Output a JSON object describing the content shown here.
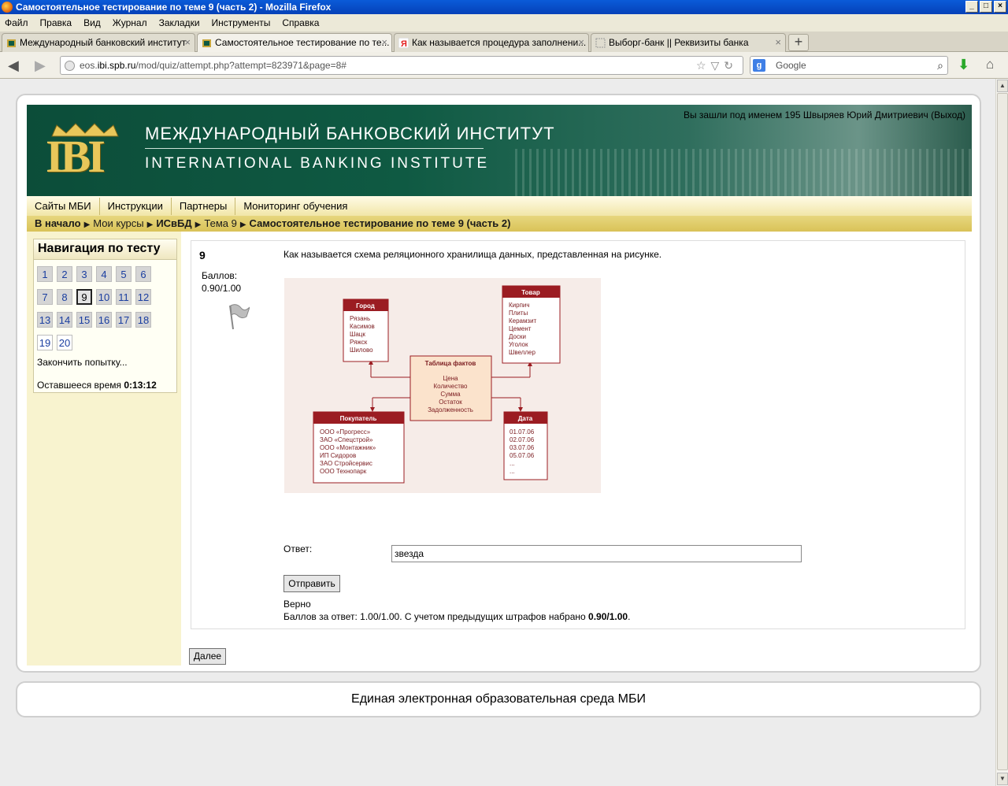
{
  "window": {
    "title": "Самостоятельное тестирование по теме 9 (часть 2) - Mozilla Firefox"
  },
  "menubar": [
    "Файл",
    "Правка",
    "Вид",
    "Журнал",
    "Закладки",
    "Инструменты",
    "Справка"
  ],
  "tabs": [
    {
      "label": "Международный банковский институт",
      "active": false
    },
    {
      "label": "Самостоятельное тестирование по те...",
      "active": true
    },
    {
      "label": "Как называется процедура заполнени...",
      "active": false
    },
    {
      "label": "Выборг-банк || Реквизиты банка",
      "active": false
    }
  ],
  "url": {
    "prefix": "eos.",
    "domain": "ibi.spb.ru",
    "path": "/mod/quiz/attempt.php?attempt=823971&page=8#"
  },
  "search": {
    "placeholder": "Google"
  },
  "header": {
    "login_text": "Вы зашли под именем 195 Швыряев Юрий Дмитриевич (Выход)",
    "logo_text": "IBI",
    "title_ru": "МЕЖДУНАРОДНЫЙ БАНКОВСКИЙ ИНСТИТУТ",
    "title_en": "INTERNATIONAL BANKING INSTITUTE"
  },
  "topmenu": [
    "Сайты МБИ",
    "Инструкции",
    "Партнеры",
    "Мониторинг обучения"
  ],
  "breadcrumb": [
    "В начало",
    "Мои курсы",
    "ИСвБД",
    "Тема 9",
    "Самостоятельное тестирование по теме 9 (часть 2)"
  ],
  "quiznav": {
    "title": "Навигация по тесту",
    "current": 9,
    "finish_label": "Закончить попытку...",
    "time_label": "Оставшееся время",
    "time_value": "0:13:12"
  },
  "question": {
    "number": "9",
    "grade_label": "Баллов:",
    "grade_value": "0.90/1.00",
    "text": "Как называется схема реляционного хранилища данных, представленная на рисунке.",
    "answer_label": "Ответ:",
    "answer_value": "звезда",
    "submit_label": "Отправить",
    "feedback_state": "Верно",
    "feedback_score_text": "Баллов за ответ: 1.00/1.00. С учетом предыдущих штрафов набрано",
    "feedback_score_value": "0.90/1.00"
  },
  "diagram": {
    "city": {
      "title": "Город",
      "items": [
        "Рязань",
        "Касимов",
        "Шацк",
        "Ряжск",
        "Шилово"
      ]
    },
    "product": {
      "title": "Товар",
      "items": [
        "Кирпич",
        "Плиты",
        "Керамзит",
        "Цемент",
        "Доски",
        "Уголок",
        "Швеллер"
      ]
    },
    "facts": {
      "title": "Таблица фактов",
      "items": [
        "Цена",
        "Количество",
        "Сумма",
        "Остаток",
        "Задолженность"
      ]
    },
    "buyer": {
      "title": "Покупатель",
      "items": [
        "ООО «Прогресс»",
        "ЗАО «Спецстрой»",
        "ООО «Монтажник»",
        "ИП Сидоров",
        "ЗАО Стройсервис",
        "ООО Технопарк"
      ]
    },
    "date": {
      "title": "Дата",
      "items": [
        "01.07.06",
        "02.07.06",
        "03.07.06",
        "05.07.06",
        "...",
        "..."
      ]
    }
  },
  "next_label": "Далее",
  "footer": "Единая электронная образовательная среда МБИ",
  "colors": {
    "banner": "#0f5a43",
    "gold": "#e8c75a",
    "table_header": "#9b1c22"
  }
}
